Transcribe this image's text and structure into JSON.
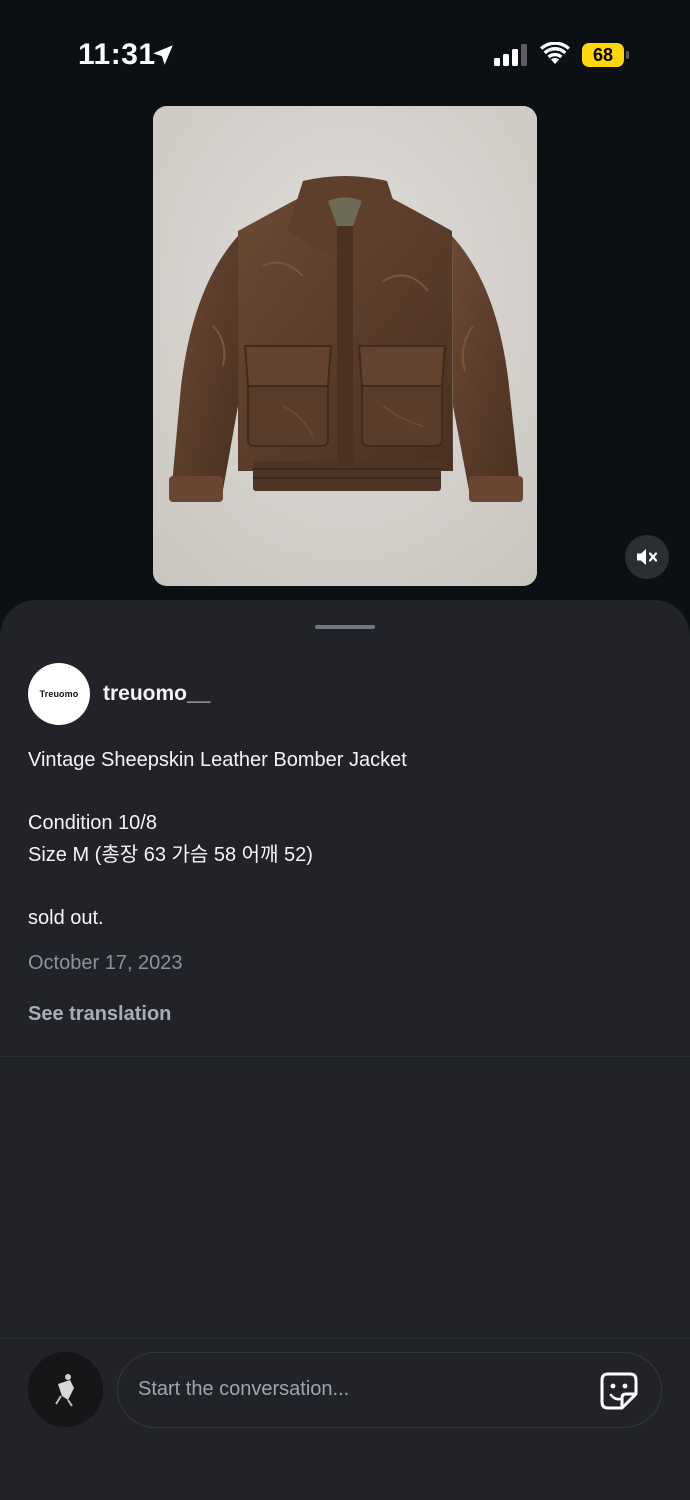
{
  "status_bar": {
    "time": "11:31",
    "battery": "68",
    "icons": [
      "location-arrow-icon",
      "cellular-signal-icon",
      "wifi-icon",
      "battery-icon"
    ]
  },
  "media": {
    "subject": "leather-bomber-jacket",
    "mute_icon": "speaker-muted-icon"
  },
  "post": {
    "avatar_text": "Treuomo",
    "username": "treuomo__",
    "caption_lines": [
      "Vintage Sheepskin Leather Bomber Jacket",
      "",
      "Condition 10/8",
      "Size M (총장 63 가슴 58 어깨 52)",
      "",
      "sold out."
    ],
    "date": "October 17, 2023",
    "see_translation": "See translation"
  },
  "composer": {
    "placeholder": "Start the conversation...",
    "sticker_icon": "sticker-icon"
  },
  "colors": {
    "background": "#0c1014",
    "sheet": "#212328",
    "battery": "#ffd60a",
    "muted_text": "#8c929c"
  }
}
